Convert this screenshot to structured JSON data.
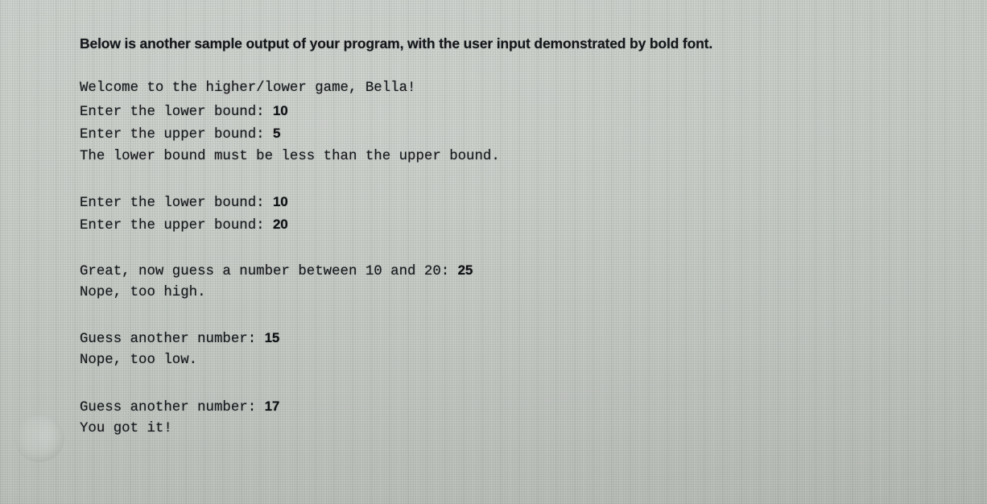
{
  "heading": {
    "text": "Below is another sample output of your program, with the user input demonstrated by bold font."
  },
  "console": {
    "lines": [
      {
        "type": "output",
        "text": "Welcome to the higher/lower game, Bella!"
      },
      {
        "type": "prompt",
        "text": "Enter the lower bound: ",
        "input": "10"
      },
      {
        "type": "prompt",
        "text": "Enter the upper bound: ",
        "input": "5"
      },
      {
        "type": "output",
        "text": "The lower bound must be less than the upper bound."
      },
      {
        "type": "blank",
        "text": ""
      },
      {
        "type": "prompt",
        "text": "Enter the lower bound: ",
        "input": "10"
      },
      {
        "type": "prompt",
        "text": "Enter the upper bound: ",
        "input": "20"
      },
      {
        "type": "blank",
        "text": ""
      },
      {
        "type": "prompt",
        "text": "Great, now guess a number between 10 and 20: ",
        "input": "25"
      },
      {
        "type": "output",
        "text": "Nope, too high."
      },
      {
        "type": "blank",
        "text": ""
      },
      {
        "type": "prompt",
        "text": "Guess another number: ",
        "input": "15"
      },
      {
        "type": "output",
        "text": "Nope, too low."
      },
      {
        "type": "blank",
        "text": ""
      },
      {
        "type": "prompt",
        "text": "Guess another number: ",
        "input": "17"
      },
      {
        "type": "output",
        "text": "You got it!"
      }
    ]
  },
  "colors": {
    "screen_background": "#bfc4bd",
    "text": "#15171b",
    "heading_text": "#14161a",
    "user_input_text": "#0d0f12"
  }
}
